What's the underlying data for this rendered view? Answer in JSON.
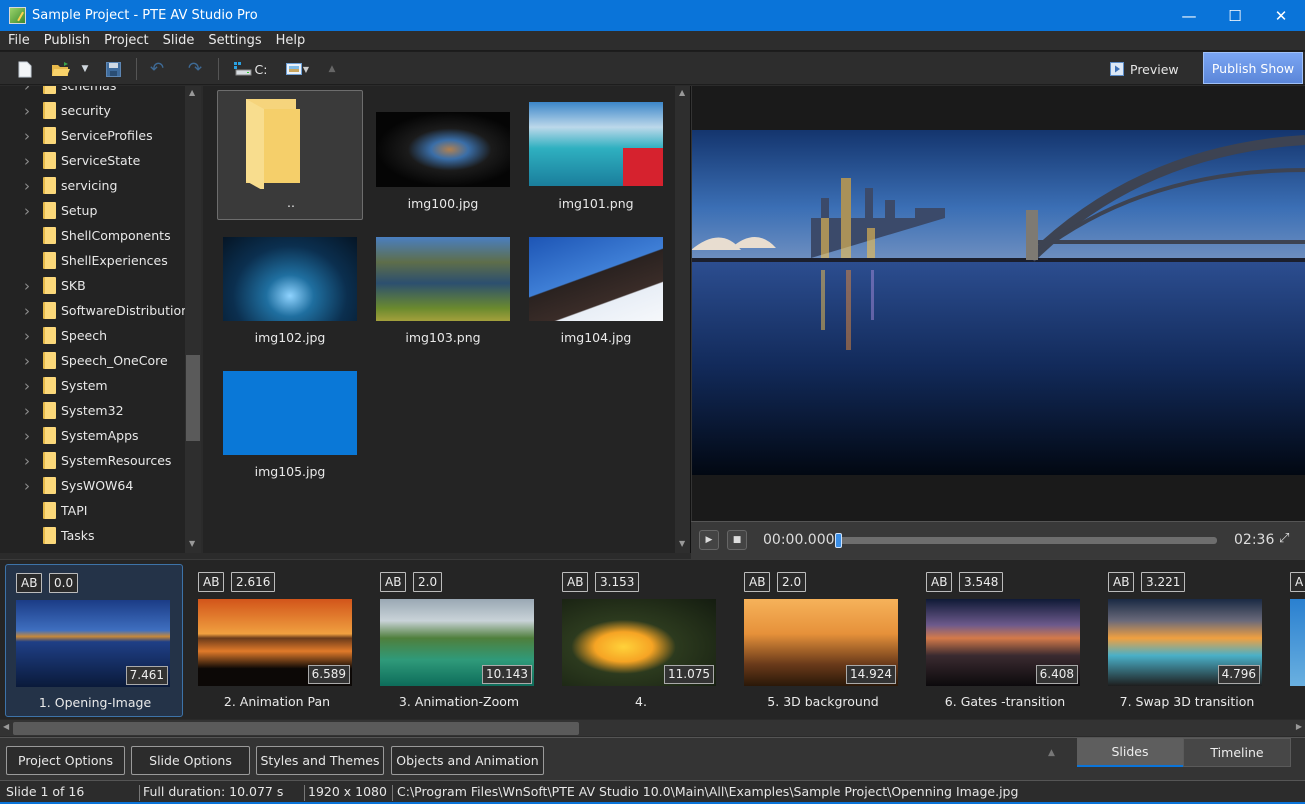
{
  "window": {
    "title": "Sample Project - PTE AV Studio Pro",
    "minimize": "—",
    "maximize": "☐",
    "close": "✕"
  },
  "menu": [
    "File",
    "Publish",
    "Project",
    "Slide",
    "Settings",
    "Help"
  ],
  "toolbar": {
    "icons": [
      "new-file-icon",
      "open-folder-icon",
      "dropdown-icon",
      "save-icon",
      "undo-icon",
      "redo-icon",
      "drive-icon",
      "view-mode-icon",
      "up-icon"
    ],
    "drive_label": "C:",
    "preview_label": "Preview",
    "publish_label": "Publish Show"
  },
  "tree": {
    "items": [
      {
        "label": "schemas",
        "expandable": true
      },
      {
        "label": "security",
        "expandable": true
      },
      {
        "label": "ServiceProfiles",
        "expandable": true
      },
      {
        "label": "ServiceState",
        "expandable": true
      },
      {
        "label": "servicing",
        "expandable": true
      },
      {
        "label": "Setup",
        "expandable": true
      },
      {
        "label": "ShellComponents",
        "expandable": false
      },
      {
        "label": "ShellExperiences",
        "expandable": false
      },
      {
        "label": "SKB",
        "expandable": true
      },
      {
        "label": "SoftwareDistribution",
        "expandable": true
      },
      {
        "label": "Speech",
        "expandable": true
      },
      {
        "label": "Speech_OneCore",
        "expandable": true
      },
      {
        "label": "System",
        "expandable": true
      },
      {
        "label": "System32",
        "expandable": true
      },
      {
        "label": "SystemApps",
        "expandable": true
      },
      {
        "label": "SystemResources",
        "expandable": true
      },
      {
        "label": "SysWOW64",
        "expandable": true
      },
      {
        "label": "TAPI",
        "expandable": false
      },
      {
        "label": "Tasks",
        "expandable": false
      }
    ]
  },
  "files": [
    {
      "name": "..",
      "type": "parent-folder"
    },
    {
      "name": "img100.jpg",
      "type": "image"
    },
    {
      "name": "img101.png",
      "type": "image"
    },
    {
      "name": "img102.jpg",
      "type": "image"
    },
    {
      "name": "img103.png",
      "type": "image"
    },
    {
      "name": "img104.jpg",
      "type": "image"
    },
    {
      "name": "img105.jpg",
      "type": "image"
    }
  ],
  "player": {
    "current_time": "00:00.000",
    "total_time": "02:36",
    "progress": 0
  },
  "slides": [
    {
      "name": "1. Opening-Image",
      "ab": "AB",
      "transition": "0.0",
      "duration": "7.461",
      "selected": true
    },
    {
      "name": "2. Animation Pan",
      "ab": "AB",
      "transition": "2.616",
      "duration": "6.589"
    },
    {
      "name": "3. Animation-Zoom",
      "ab": "AB",
      "transition": "2.0",
      "duration": "10.143"
    },
    {
      "name": "4.",
      "ab": "AB",
      "transition": "3.153",
      "duration": "11.075"
    },
    {
      "name": "5. 3D background",
      "ab": "AB",
      "transition": "2.0",
      "duration": "14.924"
    },
    {
      "name": "6. Gates -transition",
      "ab": "AB",
      "transition": "3.548",
      "duration": "6.408"
    },
    {
      "name": "7. Swap 3D transition",
      "ab": "AB",
      "transition": "3.221",
      "duration": "4.796"
    },
    {
      "name": "",
      "ab": "A",
      "transition": "",
      "duration": ""
    }
  ],
  "bottom": {
    "buttons": [
      "Project Options",
      "Slide Options",
      "Styles and Themes",
      "Objects and Animation"
    ],
    "tabs": [
      "Slides",
      "Timeline"
    ],
    "active_tab": "Slides"
  },
  "status": {
    "slide": "Slide 1 of 16",
    "duration": "Full duration: 10.077 s",
    "resolution": "1920 x 1080",
    "path": "C:\\Program Files\\WnSoft\\PTE AV Studio 10.0\\Main\\All\\Examples\\Sample Project\\Openning Image.jpg"
  },
  "colors": {
    "accent": "#0a74d9",
    "publish": "#6b96e6"
  }
}
